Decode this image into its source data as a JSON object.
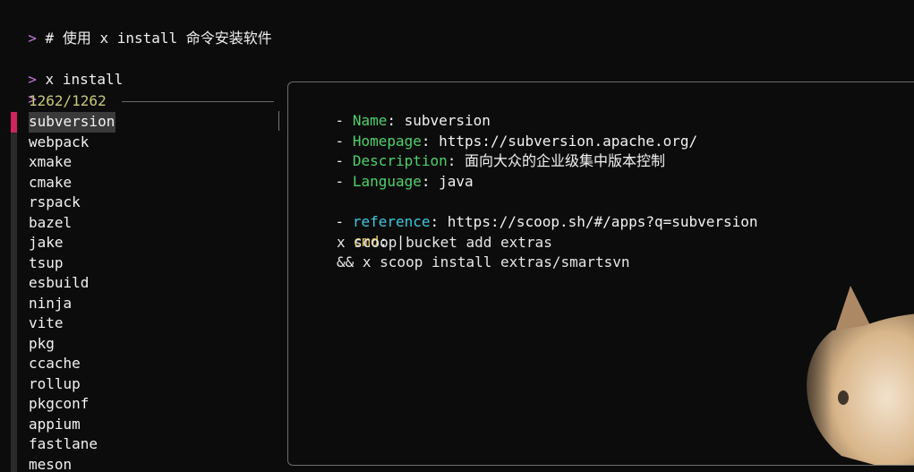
{
  "terminal": {
    "prompt_symbol": ">",
    "lines": [
      {
        "text": "# 使用 x install 命令安装软件"
      },
      {
        "text": "x install"
      },
      {
        "text": ""
      }
    ]
  },
  "list": {
    "count": "1262/1262",
    "items": [
      "subversion",
      "webpack",
      "xmake",
      "cmake",
      "rspack",
      "bazel",
      "jake",
      "tsup",
      "esbuild",
      "ninja",
      "vite",
      "pkg",
      "ccache",
      "rollup",
      "pkgconf",
      "appium",
      "fastlane",
      "meson"
    ],
    "selected_index": 0
  },
  "preview": {
    "dash": "-",
    "name_key": "Name",
    "name_value": "subversion",
    "homepage_key": "Homepage",
    "homepage_value": "https://subversion.apache.org/",
    "description_key": "Description",
    "description_value": "面向大众的企业级集中版本控制",
    "language_key": "Language",
    "language_value": "java",
    "reference_key": "reference",
    "reference_value": "https://scoop.sh/#/apps?q=subversion",
    "cmd_key": "cmd",
    "cmd_indicator": "|",
    "cmd_lines": [
      "x scoop bucket add extras",
      "&& x scoop install extras/smartsvn"
    ]
  },
  "colors": {
    "prompt": "#c678dd",
    "count": "#c8c87a",
    "selected_gutter": "#d0245e",
    "key_green": "#4ed16a",
    "key_cyan": "#3fc8e0",
    "key_yellow": "#e6c95a"
  },
  "icons": {
    "decoration": "cat-photo-icon"
  }
}
